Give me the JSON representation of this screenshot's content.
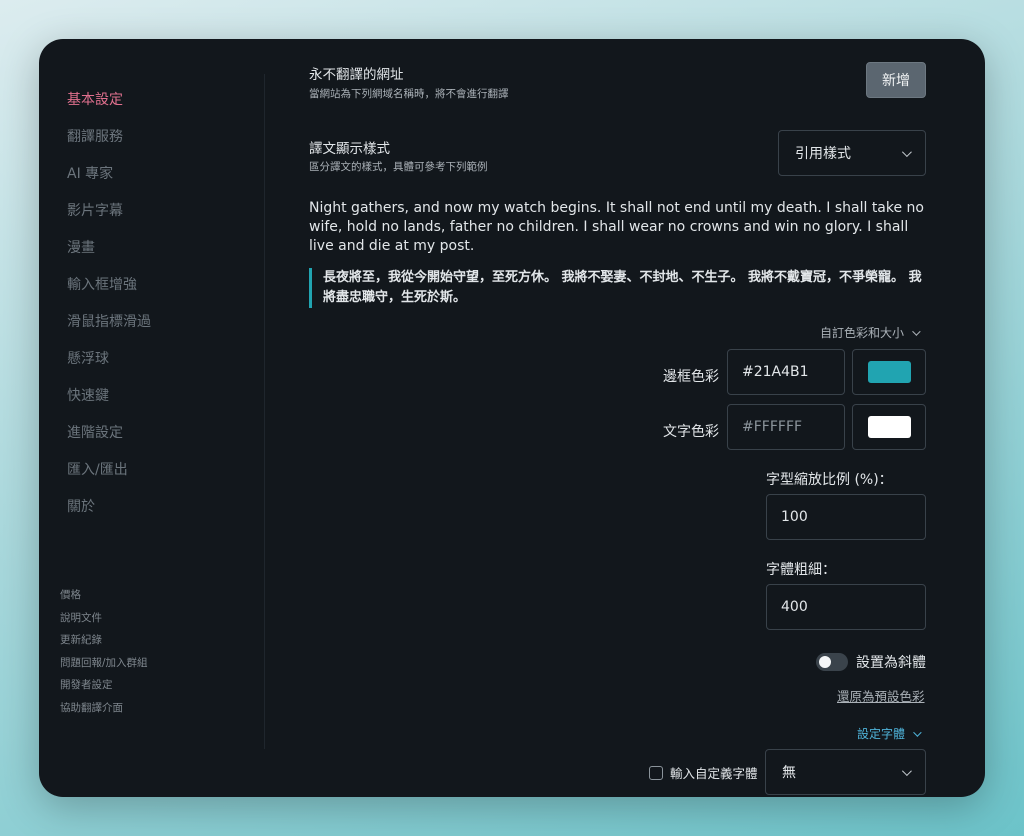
{
  "sidebar": {
    "items": [
      {
        "label": "基本設定",
        "active": true
      },
      {
        "label": "翻譯服務"
      },
      {
        "label": "AI 專家"
      },
      {
        "label": "影片字幕"
      },
      {
        "label": "漫畫"
      },
      {
        "label": "輸入框增強"
      },
      {
        "label": "滑鼠指標滑過"
      },
      {
        "label": "懸浮球"
      },
      {
        "label": "快速鍵"
      },
      {
        "label": "進階設定"
      },
      {
        "label": "匯入/匯出"
      },
      {
        "label": "關於"
      }
    ],
    "footer_links": [
      "價格",
      "說明文件",
      "更新紀錄",
      "問題回報/加入群組",
      "開發者設定",
      "協助翻譯介面"
    ]
  },
  "never_translate": {
    "title": "永不翻譯的網址",
    "subtitle": "當網站為下列網域名稱時，將不會進行翻譯",
    "add_label": "新增"
  },
  "display_style": {
    "title": "譯文顯示樣式",
    "subtitle": "區分譯文的樣式，具體可參考下列範例",
    "selected": "引用樣式"
  },
  "sample": {
    "original": "Night gathers, and now my watch begins. It shall not end until my death. I shall take no wife, hold no lands, father no children. I shall wear no crowns and win no glory. I shall live and die at my post.",
    "translated": "長夜將至，我從今開始守望，至死方休。 我將不娶妻、不封地、不生子。 我將不戴寶冠，不爭榮寵。 我將盡忠職守，生死於斯。"
  },
  "custom": {
    "toggle_label": "自訂色彩和大小",
    "border_color_label": "邊框色彩",
    "border_color_value": "#21A4B1",
    "text_color_label": "文字色彩",
    "text_color_placeholder": "#FFFFFF",
    "swatch_border": "#21a4b1",
    "swatch_text": "#ffffff",
    "font_scale_label": "字型縮放比例 (%)：",
    "font_scale_value": "100",
    "font_weight_label": "字體粗細：",
    "font_weight_value": "400",
    "italic_label": "設置為斜體",
    "italic_on": false,
    "reset_label": "還原為預設色彩"
  },
  "font": {
    "toggle_label": "設定字體",
    "custom_font_label": "輸入自定義字體",
    "selected": "無"
  },
  "colors": {
    "accent_active": "#e0708e",
    "link_blue": "#4fb3d9"
  }
}
